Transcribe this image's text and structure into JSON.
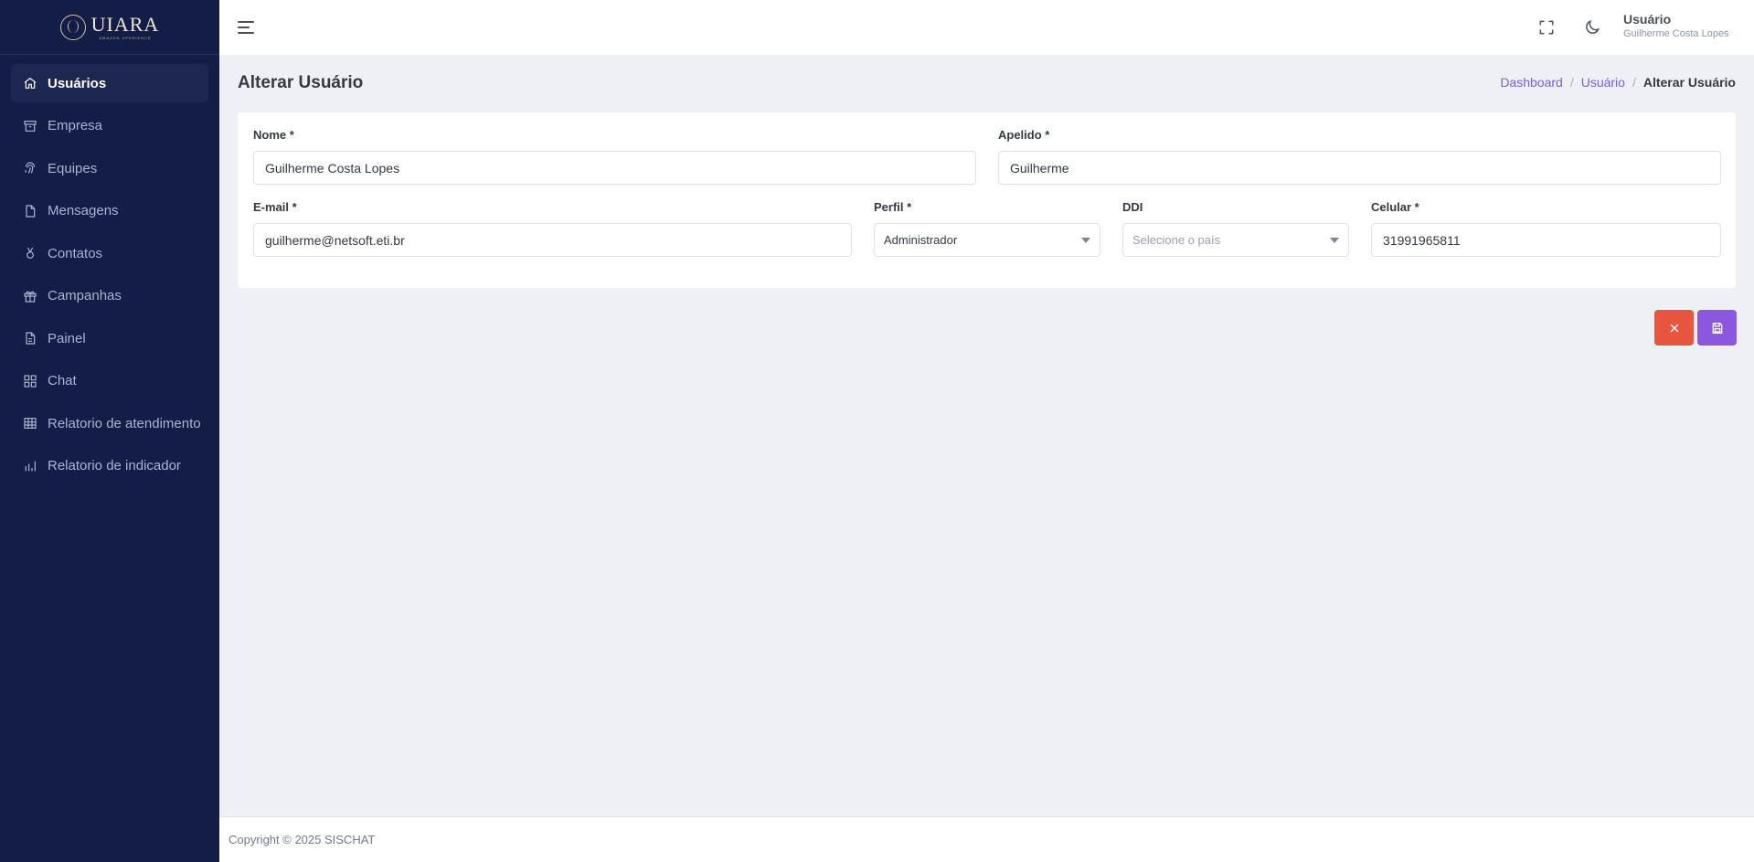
{
  "brand": {
    "title": "UIARA",
    "subtitle": "AMAZON XPERIENCE"
  },
  "sidebar": {
    "items": [
      {
        "label": "Usuários",
        "icon": "home-icon",
        "active": true
      },
      {
        "label": "Empresa",
        "icon": "archive-icon"
      },
      {
        "label": "Equipes",
        "icon": "fingerprint-icon"
      },
      {
        "label": "Mensagens",
        "icon": "file-icon"
      },
      {
        "label": "Contatos",
        "icon": "medal-icon"
      },
      {
        "label": "Campanhas",
        "icon": "gift-icon"
      },
      {
        "label": "Painel",
        "icon": "file-text-icon"
      },
      {
        "label": "Chat",
        "icon": "grid-icon"
      },
      {
        "label": "Relatorio de atendimento",
        "icon": "table-icon"
      },
      {
        "label": "Relatorio de indicador",
        "icon": "bar-chart-icon"
      }
    ]
  },
  "header": {
    "user_role": "Usuário",
    "user_name": "Guilherme Costa Lopes"
  },
  "page": {
    "title": "Alterar Usuário",
    "breadcrumb": [
      "Dashboard",
      "Usuário",
      "Alterar Usuário"
    ]
  },
  "form": {
    "nome": {
      "label": "Nome *",
      "value": "Guilherme Costa Lopes"
    },
    "apelido": {
      "label": "Apelido *",
      "value": "Guilherme"
    },
    "email": {
      "label": "E-mail *",
      "value": "guilherme@netsoft.eti.br"
    },
    "perfil": {
      "label": "Perfil *",
      "value": "Administrador"
    },
    "ddi": {
      "label": "DDI",
      "placeholder": "Selecione o país"
    },
    "celular": {
      "label": "Celular *",
      "value": "31991965811"
    }
  },
  "footer": {
    "text": "Copyright © 2025 SISCHAT"
  },
  "colors": {
    "sidebar_bg": "#131d45",
    "accent": "#7b61d6",
    "cancel": "#e8553e",
    "save": "#8b57df"
  }
}
